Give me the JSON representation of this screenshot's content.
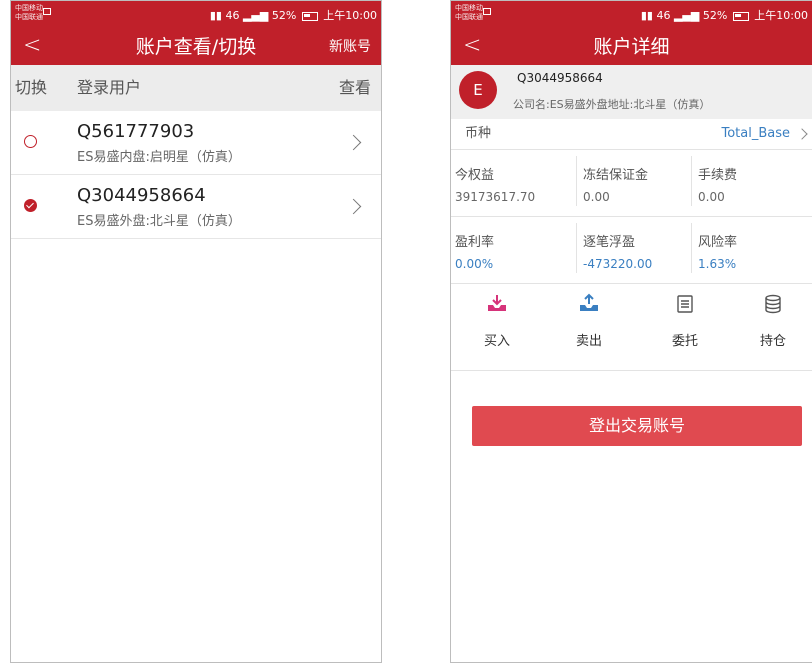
{
  "status_bar": {
    "carrier_line1": "中国移动",
    "carrier_line2": "中国联通",
    "signal_text": "46",
    "battery": "52%",
    "time": "上午10:00"
  },
  "left_screen": {
    "title": "账户查看/切换",
    "new_account": "新账号",
    "headers": {
      "switch": "切换",
      "user": "登录用户",
      "view": "查看"
    },
    "accounts": [
      {
        "id": "Q561777903",
        "desc": "ES易盛内盘:启明星（仿真）",
        "selected": false
      },
      {
        "id": "Q3044958664",
        "desc": "ES易盛外盘:北斗星（仿真）",
        "selected": true
      }
    ]
  },
  "right_screen": {
    "title": "账户详细",
    "avatar_letter": "E",
    "account_id": "Q3044958664",
    "company_info": "公司名:ES易盛外盘地址:北斗星（仿真）",
    "currency_label": "币种",
    "currency_value": "Total_Base",
    "metrics_row1": [
      {
        "label": "今权益",
        "value": "39173617.70"
      },
      {
        "label": "冻结保证金",
        "value": "0.00"
      },
      {
        "label": "手续费",
        "value": "0.00"
      }
    ],
    "metrics_row2": [
      {
        "label": "盈利率",
        "value": "0.00%"
      },
      {
        "label": "逐笔浮盈",
        "value": "-473220.00"
      },
      {
        "label": "风险率",
        "value": "1.63%"
      }
    ],
    "actions": [
      {
        "label": "买入",
        "icon": "buy-icon"
      },
      {
        "label": "卖出",
        "icon": "sell-icon"
      },
      {
        "label": "委托",
        "icon": "order-icon"
      },
      {
        "label": "持仓",
        "icon": "position-icon"
      }
    ],
    "logout_label": "登出交易账号"
  },
  "colors": {
    "brand_red": "#c0202a",
    "link_blue": "#3a7fc1",
    "button_red": "#e04a50",
    "buy_pink": "#d6337a"
  }
}
